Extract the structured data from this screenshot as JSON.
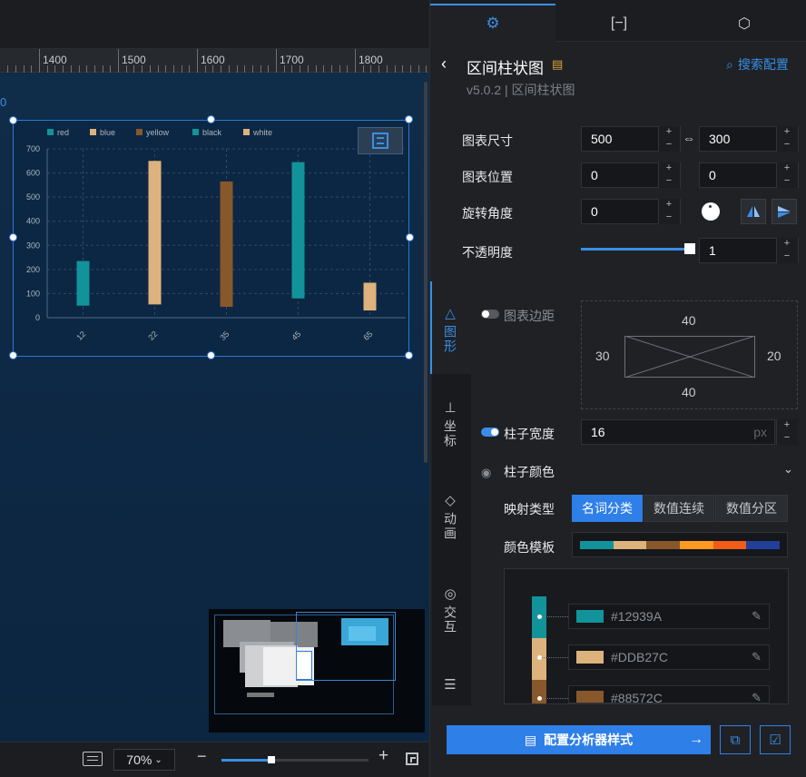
{
  "ruler": {
    "labels": [
      "1400",
      "1500",
      "1600",
      "1700",
      "1800"
    ]
  },
  "canvas": {
    "left_marker": "0"
  },
  "chart_data": {
    "type": "bar",
    "legend": [
      "red",
      "blue",
      "yellow",
      "black",
      "white"
    ],
    "categories": [
      "12",
      "22",
      "35",
      "45",
      "65"
    ],
    "yticks": [
      "700",
      "600",
      "500",
      "400",
      "300",
      "200",
      "100",
      "0"
    ],
    "ylim": [
      0,
      700
    ],
    "ranges": [
      {
        "category": "12",
        "low": 50,
        "high": 235,
        "color": "#12939A"
      },
      {
        "category": "22",
        "low": 55,
        "high": 650,
        "color": "#DDB27C"
      },
      {
        "category": "35",
        "low": 45,
        "high": 565,
        "color": "#88572C"
      },
      {
        "category": "45",
        "low": 80,
        "high": 645,
        "color": "#12939A"
      },
      {
        "category": "65",
        "low": 30,
        "high": 145,
        "color": "#DDB27C"
      }
    ],
    "legend_colors": [
      "#12939A",
      "#DDB27C",
      "#88572C",
      "#12939A",
      "#DDB27C"
    ]
  },
  "bottom": {
    "zoom": "70%"
  },
  "panel": {
    "title": "区间柱状图",
    "version": "v5.0.2 | 区间柱状图",
    "search_label": "搜索配置",
    "size_label": "图表尺寸",
    "width": "500",
    "height": "300",
    "position_label": "图表位置",
    "pos_x": "0",
    "pos_y": "0",
    "rotate_label": "旋转角度",
    "rotate": "0",
    "opacity_label": "不透明度",
    "opacity": "1",
    "opacity_level": 1,
    "margin_label": "图表边距",
    "margin_top": "40",
    "margin_bottom": "40",
    "margin_left": "30",
    "margin_right": "20",
    "bar_width_label": "柱子宽度",
    "bar_width": "16",
    "bar_width_unit": "px",
    "bar_color_label": "柱子颜色",
    "map_type_label": "映射类型",
    "map_types": [
      "名词分类",
      "数值连续",
      "数值分区"
    ],
    "template_label": "颜色模板",
    "template_colors": [
      "#12939A",
      "#DDB27C",
      "#88572C",
      "#FF991F",
      "#F15C17",
      "#223F9A"
    ],
    "color_rows": [
      {
        "color": "#12939A",
        "hex": "#12939A"
      },
      {
        "color": "#DDB27C",
        "hex": "#DDB27C"
      },
      {
        "color": "#88572C",
        "hex": "#88572C"
      }
    ],
    "vtabs": [
      "图形",
      "坐标",
      "动画",
      "交互"
    ],
    "analyzer_button": "配置分析器样式"
  }
}
